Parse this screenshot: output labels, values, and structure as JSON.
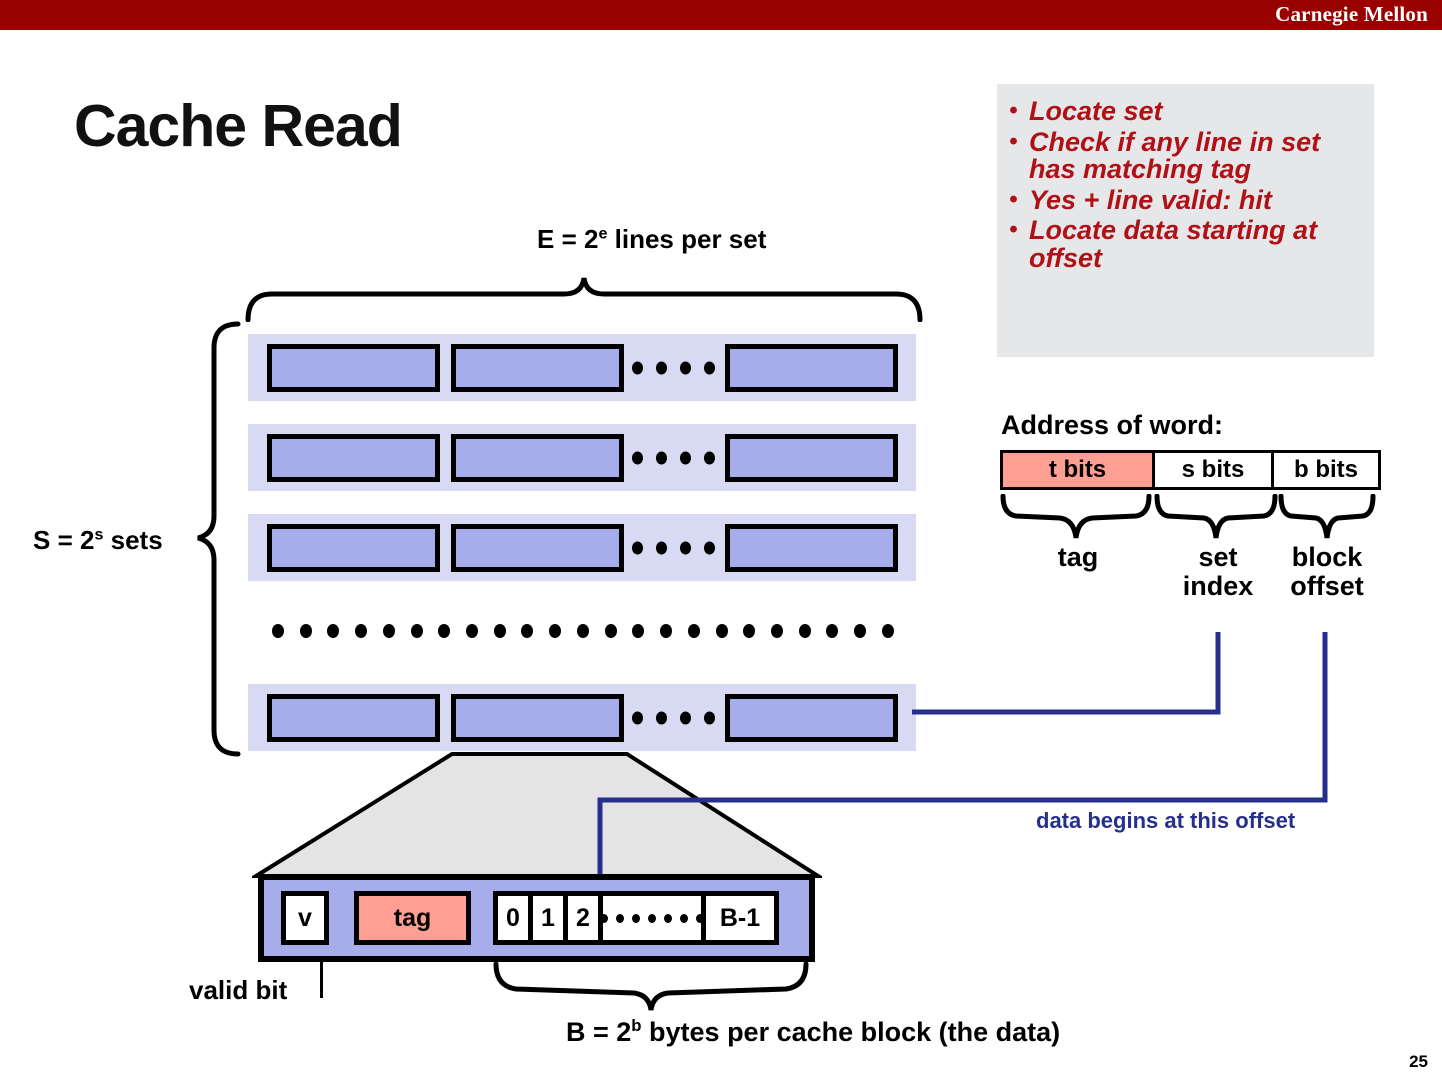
{
  "header": {
    "brand": "Carnegie Mellon",
    "bar_color": "#990000"
  },
  "slide": {
    "title": "Cache Read",
    "page_number": "25"
  },
  "bullets": {
    "panel_bg": "#e6e7e8",
    "text_color": "#b01116",
    "items": [
      "Locate set",
      "Check if any line in set has matching tag",
      "Yes + line valid: hit",
      "Locate data starting at offset"
    ]
  },
  "cache_diagram": {
    "lines_per_set_label": "E = 2e lines per set",
    "lines_per_set_parts": {
      "prefix": "E = 2",
      "exp": "e",
      "suffix": " lines per set"
    },
    "sets_label": "S = 2s sets",
    "sets_parts": {
      "prefix": "S = 2",
      "exp": "s",
      "suffix": " sets"
    },
    "set_bg_color": "#d7daf2",
    "line_box_color": "#a7adea",
    "num_visible_sets": 4,
    "lines_shown_per_set": 3,
    "inline_dot_count": 4,
    "set_ellipsis_dot_count": 23
  },
  "address": {
    "title": "Address of word:",
    "fields": [
      {
        "label": "t bits",
        "color": "#ff9e92"
      },
      {
        "label": "s bits",
        "color": "#ffffff"
      },
      {
        "label": "b bits",
        "color": "#ffffff"
      }
    ],
    "sub_labels": [
      "tag",
      "set index",
      "block offset"
    ],
    "sub_tag": "tag",
    "sub_set_line1": "set",
    "sub_set_line2": "index",
    "sub_block_line1": "block",
    "sub_block_line2": "offset"
  },
  "connectors": {
    "color": "#26308c",
    "offset_note": "data begins at this offset"
  },
  "line_detail": {
    "valid_cell": "v",
    "tag_cell": "tag",
    "tag_color": "#ff9e92",
    "bytes": [
      "0",
      "1",
      "2",
      "",
      "B-1"
    ],
    "byte_dots_count": 7,
    "valid_bit_label": "valid bit",
    "block_caption": "B = 2b bytes per cache block (the data)",
    "block_caption_parts": {
      "prefix": "B = 2",
      "exp": "b",
      "suffix": " bytes per cache block (the data)"
    }
  }
}
